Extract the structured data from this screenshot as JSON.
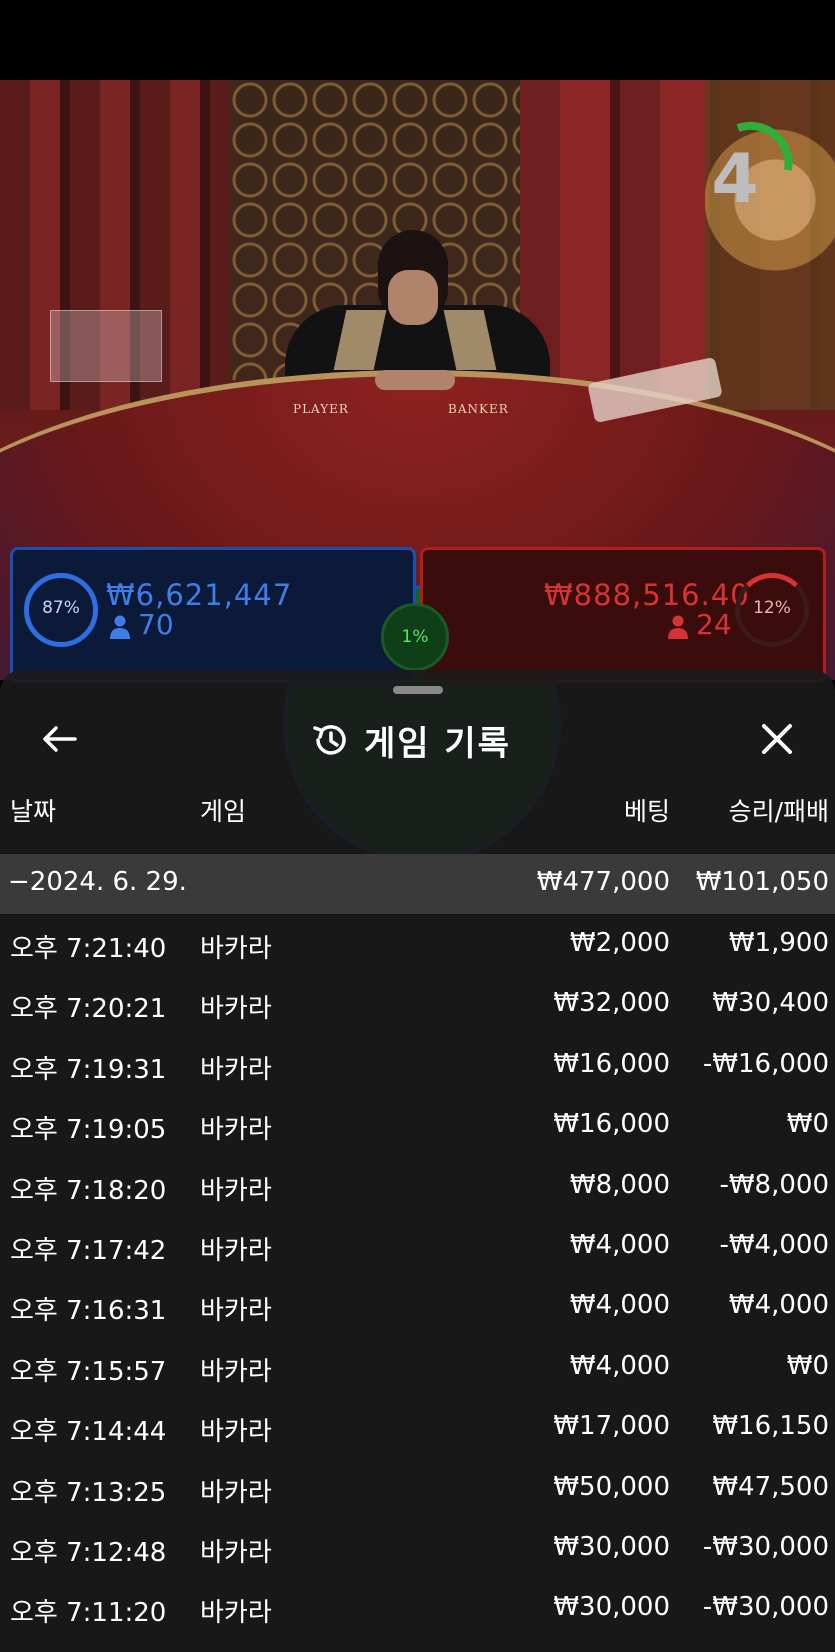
{
  "game_view": {
    "timer_count": "4",
    "table_labels": {
      "player": "PLAYER",
      "banker": "BANKER"
    },
    "player_panel": {
      "percent": "87%",
      "amount": "₩6,621,447",
      "players": "70",
      "percent_value": 87,
      "color": "#2f6ee0"
    },
    "banker_panel": {
      "percent": "12%",
      "amount": "₩888,516.40",
      "players": "24",
      "percent_value": 12,
      "color": "#d63333"
    },
    "tie_panel": {
      "percent": "1%",
      "color": "#2fae3a"
    }
  },
  "sheet": {
    "title": "게임 기록",
    "back_icon": "arrow-left-icon",
    "history_icon": "history-icon",
    "close_icon": "close-icon",
    "columns": {
      "date": "날짜",
      "game": "게임",
      "bet": "베팅",
      "result": "승리/패배"
    },
    "date_group": {
      "label": "−2024. 6. 29.",
      "bet_total": "₩477,000",
      "result_total": "₩101,050"
    },
    "rows": [
      {
        "time": "오후 7:21:40",
        "game": "바카라",
        "bet": "₩2,000",
        "result": "₩1,900"
      },
      {
        "time": "오후 7:20:21",
        "game": "바카라",
        "bet": "₩32,000",
        "result": "₩30,400"
      },
      {
        "time": "오후 7:19:31",
        "game": "바카라",
        "bet": "₩16,000",
        "result": "-₩16,000"
      },
      {
        "time": "오후 7:19:05",
        "game": "바카라",
        "bet": "₩16,000",
        "result": "₩0"
      },
      {
        "time": "오후 7:18:20",
        "game": "바카라",
        "bet": "₩8,000",
        "result": "-₩8,000"
      },
      {
        "time": "오후 7:17:42",
        "game": "바카라",
        "bet": "₩4,000",
        "result": "-₩4,000"
      },
      {
        "time": "오후 7:16:31",
        "game": "바카라",
        "bet": "₩4,000",
        "result": "₩4,000"
      },
      {
        "time": "오후 7:15:57",
        "game": "바카라",
        "bet": "₩4,000",
        "result": "₩0"
      },
      {
        "time": "오후 7:14:44",
        "game": "바카라",
        "bet": "₩17,000",
        "result": "₩16,150"
      },
      {
        "time": "오후 7:13:25",
        "game": "바카라",
        "bet": "₩50,000",
        "result": "₩47,500"
      },
      {
        "time": "오후 7:12:48",
        "game": "바카라",
        "bet": "₩30,000",
        "result": "-₩30,000"
      },
      {
        "time": "오후 7:11:20",
        "game": "바카라",
        "bet": "₩30,000",
        "result": "-₩30,000"
      }
    ]
  }
}
